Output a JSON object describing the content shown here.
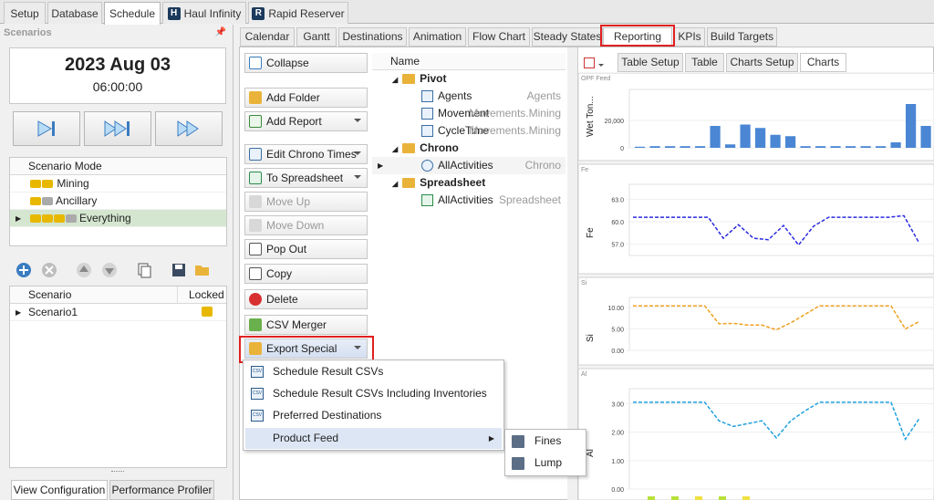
{
  "top_tabs": {
    "setup": "Setup",
    "database": "Database",
    "schedule": "Schedule",
    "haul": "Haul Infinity",
    "rapid": "Rapid Reserver"
  },
  "left": {
    "title": "Scenarios",
    "date": "2023 Aug 03",
    "time": "06:00:00",
    "mode_header": "Scenario Mode",
    "modes": [
      "Mining",
      "Ancillary",
      "Everything"
    ],
    "scenario_header": "Scenario",
    "locked_header": "Locked",
    "scenarios": [
      "Scenario1"
    ],
    "bottom_tabs": [
      "View Configuration",
      "Performance Profiler"
    ]
  },
  "sub_tabs": [
    "Calendar",
    "Gantt",
    "Destinations",
    "Animation",
    "Flow Chart",
    "Steady States",
    "Reporting",
    "KPIs",
    "Build Targets"
  ],
  "buttons": {
    "collapse": "Collapse",
    "add_folder": "Add Folder",
    "add_report": "Add Report",
    "edit_chrono": "Edit Chrono Times",
    "to_spreadsheet": "To Spreadsheet",
    "move_up": "Move Up",
    "move_down": "Move Down",
    "pop_out": "Pop Out",
    "copy": "Copy",
    "delete": "Delete",
    "csv_merger": "CSV Merger",
    "export_special": "Export Special"
  },
  "tree": {
    "header": "Name",
    "pivot": "Pivot",
    "agents": "Agents",
    "agents_type": "Agents",
    "movement": "Movement",
    "movement_type": "Movements.Mining",
    "cycletime": "CycleTime",
    "cycletime_type": "Movements.Mining",
    "chrono": "Chrono",
    "allact1": "AllActivities",
    "allact1_type": "Chrono",
    "spreadsheet": "Spreadsheet",
    "allact2": "AllActivities",
    "allact2_type": "Spreadsheet"
  },
  "view_tabs": [
    "Table Setup",
    "Table",
    "Charts Setup",
    "Charts"
  ],
  "menu": {
    "items": [
      "Schedule Result CSVs",
      "Schedule Result CSVs Including Inventories",
      "Preferred Destinations",
      "Product Feed"
    ],
    "sub": [
      "Fines",
      "Lump"
    ]
  },
  "chart_data": [
    {
      "type": "bar",
      "title": "OPF Feed",
      "ylabel": "Wet Ton...",
      "yticks": [
        "20,000",
        "0"
      ],
      "ylim": [
        0,
        40000
      ],
      "values": [
        800,
        1200,
        1200,
        1200,
        1200,
        16000,
        2500,
        17000,
        14500,
        9500,
        8500,
        1200,
        1200,
        1200,
        1200,
        1200,
        1200,
        4000,
        32000,
        16000
      ],
      "color": "#4a86d4"
    },
    {
      "type": "line",
      "title": "Fe",
      "ylabel": "Fe",
      "yticks": [
        "63.0",
        "60.0",
        "57.0"
      ],
      "ylim": [
        55.5,
        64.5
      ],
      "values": [
        60.6,
        60.6,
        60.6,
        60.6,
        60.6,
        60.6,
        57.8,
        59.6,
        57.8,
        57.6,
        59.5,
        56.9,
        59.4,
        60.6,
        60.6,
        60.6,
        60.6,
        60.6,
        60.8,
        57.2
      ],
      "color": "#2a2ae0"
    },
    {
      "type": "line",
      "title": "Si",
      "ylabel": "Si",
      "yticks": [
        "10.00",
        "5.00",
        "0.00"
      ],
      "ylim": [
        0,
        11.5
      ],
      "values": [
        10.4,
        10.4,
        10.4,
        10.4,
        10.4,
        10.4,
        6.2,
        6.3,
        5.9,
        5.9,
        4.8,
        6.4,
        8.4,
        10.4,
        10.4,
        10.4,
        10.4,
        10.4,
        10.4,
        5.0,
        6.8
      ],
      "color": "#f0a020"
    },
    {
      "type": "line",
      "title": "Al",
      "ylabel": "Al",
      "yticks": [
        "3.00",
        "2.00",
        "1.00",
        "0.00"
      ],
      "ylim": [
        0,
        3.4
      ],
      "values": [
        3.05,
        3.05,
        3.05,
        3.05,
        3.05,
        3.05,
        2.4,
        2.2,
        2.3,
        2.4,
        1.8,
        2.4,
        2.75,
        3.05,
        3.05,
        3.05,
        3.05,
        3.05,
        3.05,
        1.75,
        2.5
      ],
      "color": "#1ea0e0"
    }
  ]
}
